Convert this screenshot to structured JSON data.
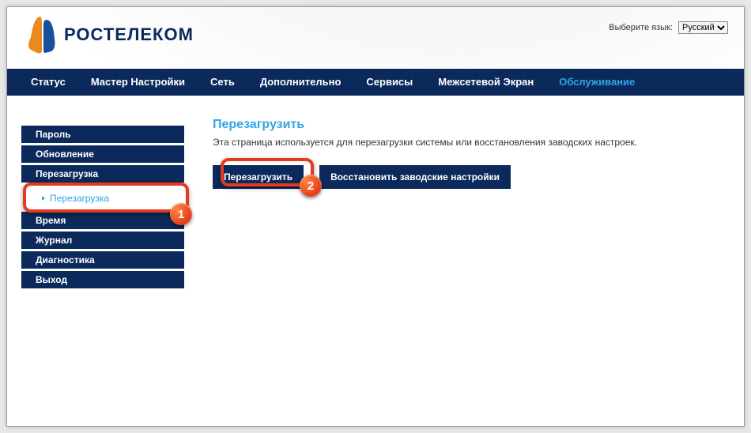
{
  "lang": {
    "label": "Выберите язык:",
    "selected": "Русский"
  },
  "brand": "РОСТЕЛЕКОМ",
  "topnav": [
    "Статус",
    "Мастер Настройки",
    "Сеть",
    "Дополнительно",
    "Сервисы",
    "Межсетевой Экран",
    "Обслуживание"
  ],
  "topnav_active_index": 6,
  "sidebar": {
    "items": [
      "Пароль",
      "Обновление",
      "Перезагрузка",
      "Время",
      "Журнал",
      "Диагностика",
      "Выход"
    ],
    "subitem": "Перезагрузка",
    "sub_after_index": 2
  },
  "content": {
    "title": "Перезагрузить",
    "desc": "Эта страница используется для перезагрузки системы или восстановления заводских настроек.",
    "btn_reboot": "Перезагрузить",
    "btn_restore": "Восстановить заводские настройки"
  },
  "annotations": {
    "b1": "1",
    "b2": "2"
  }
}
